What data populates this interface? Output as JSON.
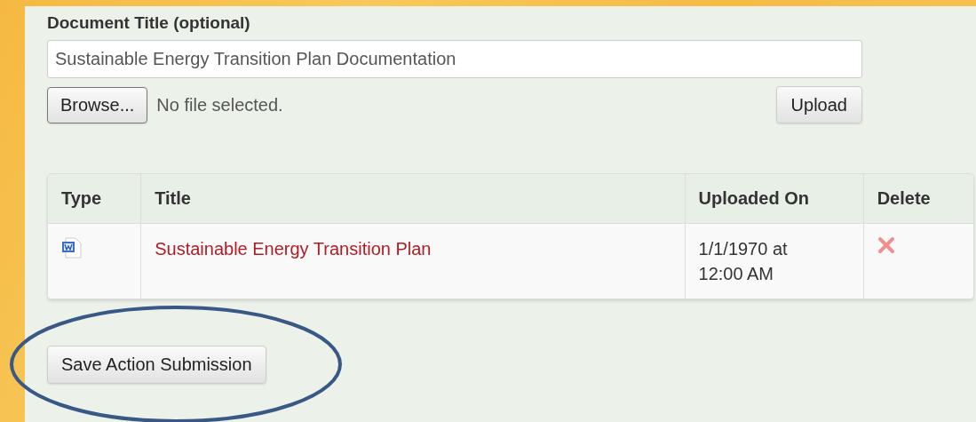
{
  "title_field": {
    "label": "Document Title (optional)",
    "value": "Sustainable Energy Transition Plan Documentation"
  },
  "file_picker": {
    "button": "Browse...",
    "status": "No file selected."
  },
  "upload_button": "Upload",
  "table": {
    "columns": [
      "Type",
      "Title",
      "Uploaded On",
      "Delete"
    ],
    "rows": [
      {
        "kind": "word",
        "title": "Sustainable Energy Transition Plan",
        "uploaded_on": "1/1/1970 at 12:00 AM"
      }
    ]
  },
  "save_button": "Save Action Submission"
}
